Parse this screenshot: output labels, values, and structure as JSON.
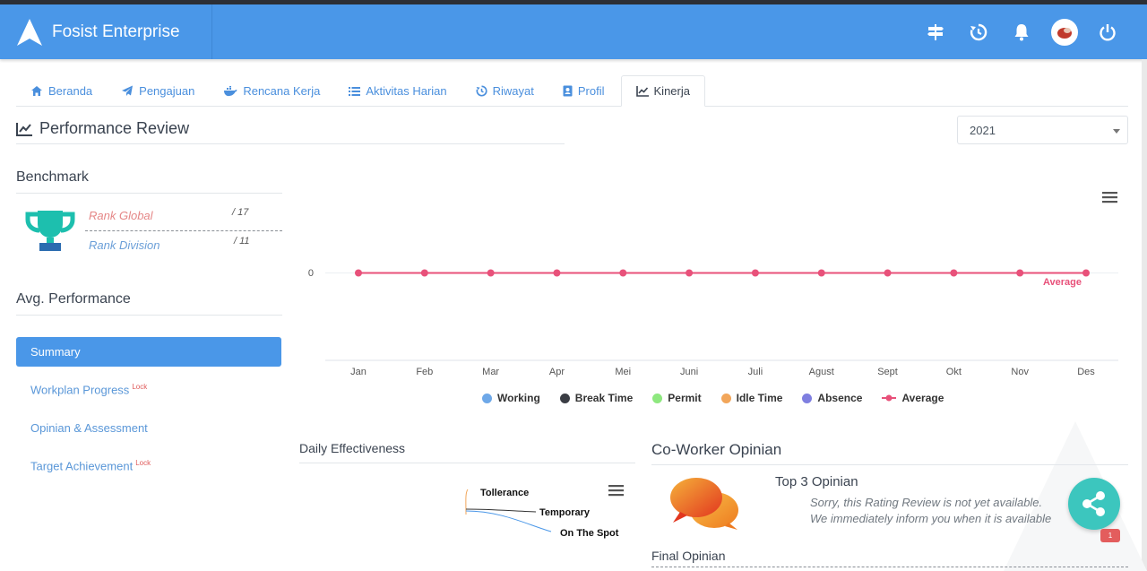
{
  "app": {
    "title": "Fosist Enterprise"
  },
  "header_icons": [
    "signpost-icon",
    "history-icon",
    "bell-icon",
    "avatar",
    "power-icon"
  ],
  "tabs": [
    {
      "label": "Beranda",
      "icon": "home-icon"
    },
    {
      "label": "Pengajuan",
      "icon": "paper-plane-icon"
    },
    {
      "label": "Rencana Kerja",
      "icon": "docker-icon"
    },
    {
      "label": "Aktivitas Harian",
      "icon": "list-icon"
    },
    {
      "label": "Riwayat",
      "icon": "history-icon"
    },
    {
      "label": "Profil",
      "icon": "id-card-icon"
    },
    {
      "label": "Kinerja",
      "icon": "line-chart-icon",
      "active": true
    }
  ],
  "page": {
    "title": "Performance Review",
    "year": "2021"
  },
  "benchmark": {
    "title": "Benchmark",
    "rank_global_label": "Rank Global",
    "rank_global_value": "/ 17",
    "rank_division_label": "Rank Division",
    "rank_division_value": "/ 11"
  },
  "avg_performance": {
    "title": "Avg. Performance",
    "items": [
      {
        "label": "Summary",
        "active": true,
        "locked": false
      },
      {
        "label": "Workplan Progress",
        "locked": true
      },
      {
        "label": "Opinian & Assessment",
        "locked": false
      },
      {
        "label": "Target Achievement",
        "locked": true
      }
    ],
    "lock_label": "Lock"
  },
  "chart_data": {
    "type": "line",
    "categories": [
      "Jan",
      "Feb",
      "Mar",
      "Apr",
      "Mei",
      "Juni",
      "Juli",
      "Agust",
      "Sept",
      "Okt",
      "Nov",
      "Des"
    ],
    "series": [
      {
        "name": "Average",
        "values": [
          0,
          0,
          0,
          0,
          0,
          0,
          0,
          0,
          0,
          0,
          0,
          0
        ],
        "color": "#e8517a"
      }
    ],
    "legend": [
      {
        "name": "Working",
        "color": "#6ea8e8"
      },
      {
        "name": "Break Time",
        "color": "#3a3d44"
      },
      {
        "name": "Permit",
        "color": "#8ee87f"
      },
      {
        "name": "Idle Time",
        "color": "#f2a65a"
      },
      {
        "name": "Absence",
        "color": "#7f7fe0"
      },
      {
        "name": "Average",
        "color": "#e8517a"
      }
    ],
    "y_tick": "0",
    "series_label": "Average",
    "legend_position": "bottom"
  },
  "daily_effectiveness": {
    "title": "Daily Effectiveness",
    "labels": [
      "Tollerance",
      "Temporary",
      "On The Spot"
    ]
  },
  "coworker": {
    "title": "Co-Worker Opinian",
    "top3_title": "Top 3 Opinian",
    "message_1": "Sorry, this Rating Review is not yet available.",
    "message_2": "We immediately inform you when it is available",
    "final_title": "Final Opinian"
  },
  "share": {
    "badge": "1"
  }
}
